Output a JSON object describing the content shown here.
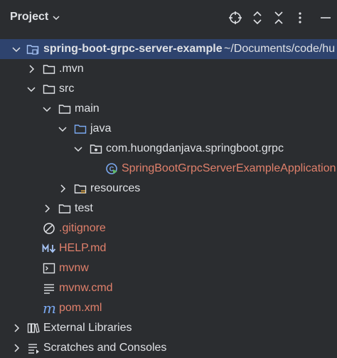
{
  "header": {
    "title": "Project",
    "icons": [
      "target-icon",
      "expand-icon",
      "collapse-icon",
      "more-icon",
      "minimize-icon"
    ]
  },
  "tree": {
    "root_name": "spring-boot-grpc-server-example",
    "root_path": "~/Documents/code/hu",
    "mvn": ".mvn",
    "src": "src",
    "main": "main",
    "java": "java",
    "package": "com.huongdanjava.springboot.grpc",
    "app_class": "SpringBootGrpcServerExampleApplication",
    "resources": "resources",
    "test": "test",
    "gitignore": ".gitignore",
    "help": "HELP.md",
    "mvnw": "mvnw",
    "mvnw_cmd": "mvnw.cmd",
    "pom": "pom.xml",
    "external_libraries": "External Libraries",
    "scratches": "Scratches and Consoles"
  },
  "colors": {
    "background": "#2b2d30",
    "selected": "#2e436e",
    "text": "#dfe1e5",
    "unversioned": "#e0806b",
    "accent": "#7aa8f0"
  }
}
